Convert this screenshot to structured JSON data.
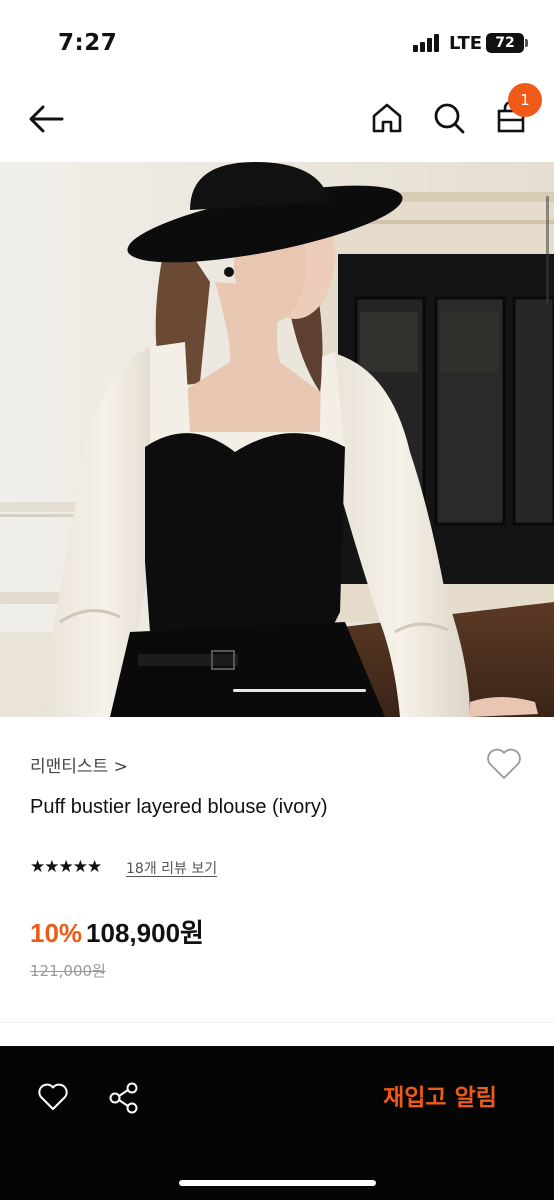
{
  "status_bar": {
    "time": "7:27",
    "network": "LTE",
    "battery": "72"
  },
  "header": {
    "back_icon": "arrow-left-icon",
    "home_icon": "home-icon",
    "search_icon": "search-icon",
    "cart_icon": "shopping-bag-icon",
    "cart_badge_count": "1"
  },
  "product": {
    "brand": "리맨티스트 >",
    "name": "Puff bustier layered blouse (ivory)",
    "rating_stars": "★★★★★",
    "rating_value": 5,
    "review_link": "18개 리뷰 보기",
    "discount": "10%",
    "price": "108,900원",
    "original_price": "121,000원",
    "image_page": 1
  },
  "action_bar": {
    "wishlist_icon": "heart-outline-icon",
    "share_icon": "share-icon",
    "restock_label": "재입고 알림"
  },
  "colors": {
    "accent": "#ef5a18",
    "bar_background": "#050505",
    "text_primary": "#111111",
    "text_muted": "#999999"
  }
}
